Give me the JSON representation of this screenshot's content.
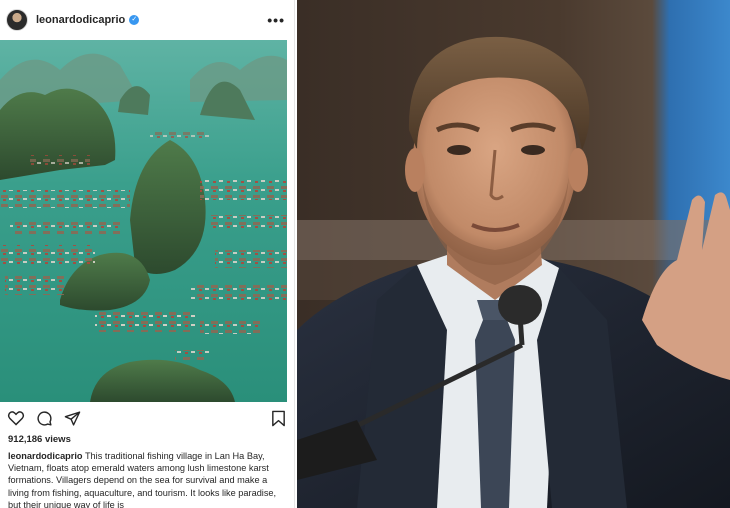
{
  "post": {
    "username": "leonardodicaprio",
    "verified_icon": "verified-badge-icon",
    "more_icon": "more-options-icon",
    "views": "912,186 views",
    "caption_user": "leonardodicaprio",
    "caption_text": "This traditional fishing village in Lan Ha Bay, Vietnam, floats atop emerald waters among lush limestone karst formations. Villagers depend on the sea for survival and make a living from fishing, aquaculture, and tourism. It looks like paradise, but their unique way of life is",
    "action_icons": [
      "heart-icon",
      "comment-icon",
      "share-icon",
      "bookmark-icon"
    ]
  },
  "colors": {
    "verified": "#3897f0",
    "text": "#262626",
    "water": "#2f9a86",
    "suit": "#1f2530"
  }
}
